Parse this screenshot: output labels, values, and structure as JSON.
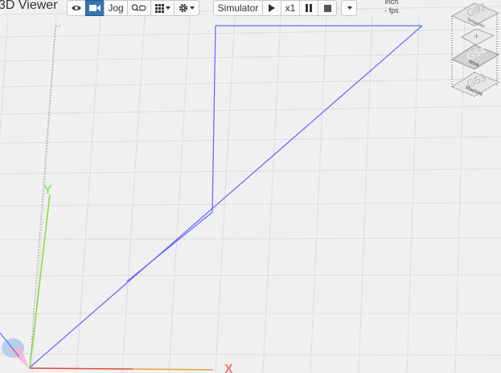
{
  "viewer": {
    "title": "3D Viewer"
  },
  "toolbar": {
    "view_icon": "eye-icon",
    "camera_icon": "video-camera-icon",
    "jog_label": "Jog",
    "probe_icon": "probe-icon",
    "grid_icon": "grid-icon",
    "settings_icon": "gear-icon",
    "simulator_label": "Simulator",
    "play_icon": "play-icon",
    "speed_label": "x1",
    "pause_icon": "pause-icon",
    "stop_icon": "stop-icon",
    "more_icon": "chevron-down-icon"
  },
  "status": {
    "units": "inch",
    "fps": "- fps"
  },
  "coordinate_stack": {
    "g92": {
      "code": "G92",
      "label": "Temporary"
    },
    "g54": {
      "code": "G54",
      "label": "Work"
    },
    "g53": {
      "code": "G53",
      "label": "Machine"
    },
    "plus_label": "+"
  },
  "axes": {
    "x_label": "X",
    "y_label": "Y"
  },
  "colors": {
    "active_button": "#3276b1",
    "toolpath": "#6b6bff",
    "x_axis": "#e04a3a",
    "y_axis": "#7fdc3a"
  }
}
